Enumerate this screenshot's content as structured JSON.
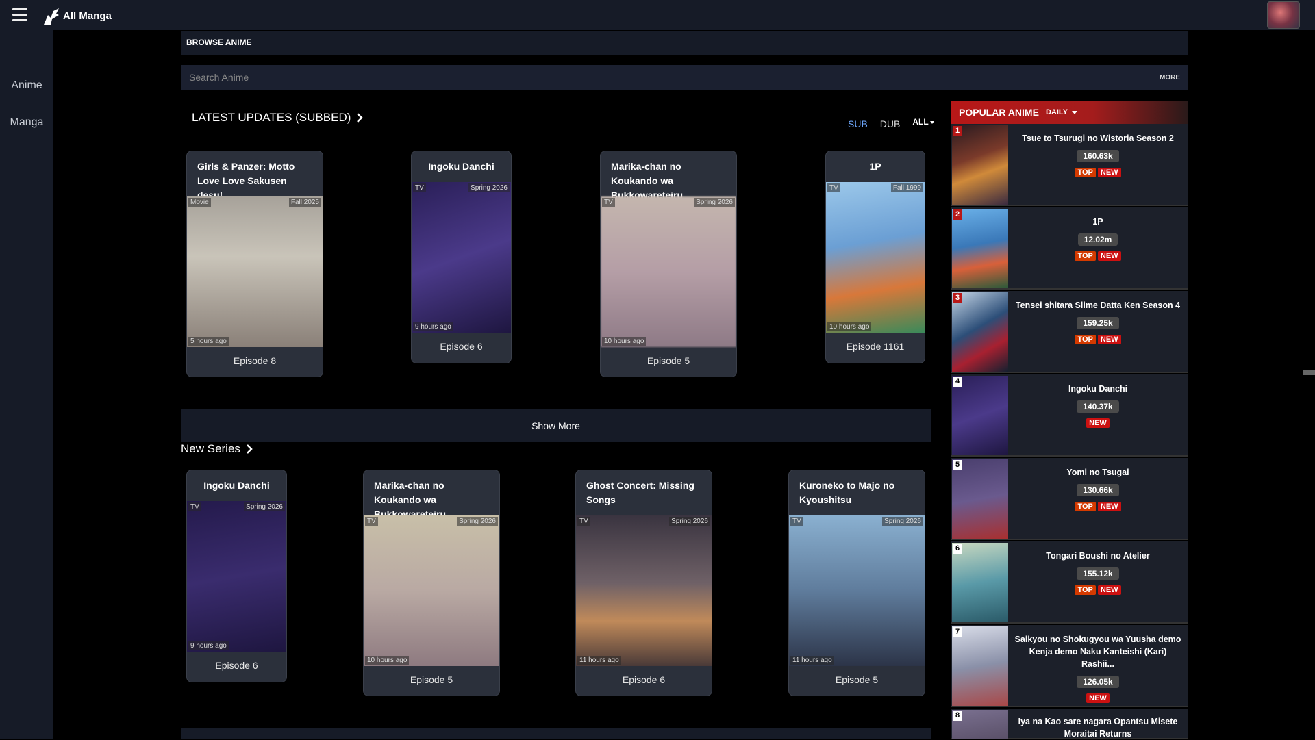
{
  "header": {
    "logo_text": "All Manga"
  },
  "sidebar": {
    "items": [
      {
        "label": "Anime"
      },
      {
        "label": "Manga"
      }
    ]
  },
  "browse": {
    "title": "BROWSE ANIME"
  },
  "search": {
    "placeholder": "Search Anime",
    "more_label": "MORE"
  },
  "latest": {
    "title": "LATEST UPDATES (SUBBED)",
    "toggles": {
      "sub": "SUB",
      "dub": "DUB",
      "all": "ALL"
    },
    "cards": [
      {
        "title": "Girls & Panzer: Motto Love Love Sakusen desu!",
        "type": "Movie",
        "season": "Fall 2025",
        "time": "5 hours ago",
        "episode": "Episode 8",
        "color": "#c9c4b9"
      },
      {
        "title": "Ingoku Danchi",
        "type": "TV",
        "season": "Spring 2026",
        "time": "9 hours ago",
        "episode": "Episode 6",
        "color": "#3b2a6e"
      },
      {
        "title": "Marika-chan no Koukando wa Bukkowareteiru",
        "type": "TV",
        "season": "Spring 2026",
        "time": "10 hours ago",
        "episode": "Episode 5",
        "color": "#b8a6a8"
      },
      {
        "title": "1P",
        "type": "TV",
        "season": "Fall 1999",
        "time": "10 hours ago",
        "episode": "Episode 1161",
        "color": "#6b9fd4"
      }
    ],
    "show_more": "Show More"
  },
  "new_series": {
    "title": "New Series",
    "cards": [
      {
        "title": "Ingoku Danchi",
        "type": "TV",
        "season": "Spring 2026",
        "time": "9 hours ago",
        "episode": "Episode 6",
        "color": "#2f2460"
      },
      {
        "title": "Marika-chan no Koukando wa Bukkowareteiru",
        "type": "TV",
        "season": "Spring 2026",
        "time": "10 hours ago",
        "episode": "Episode 5",
        "color": "#b9a9a3"
      },
      {
        "title": "Ghost Concert: Missing Songs",
        "type": "TV",
        "season": "Spring 2026",
        "time": "11 hours ago",
        "episode": "Episode 6",
        "color": "#6f6167"
      },
      {
        "title": "Kuroneko to Majo no Kyoushitsu",
        "type": "TV",
        "season": "Spring 2026",
        "time": "11 hours ago",
        "episode": "Episode 5",
        "color": "#5f7c9c"
      }
    ]
  },
  "popular": {
    "title": "POPULAR ANIME",
    "period": "DAILY",
    "items": [
      {
        "rank": "1",
        "name": "Tsue to Tsurugi no Wistoria Season 2",
        "views": "160.63k",
        "top": "TOP",
        "new": "NEW",
        "color": "#7a3a2a"
      },
      {
        "rank": "2",
        "name": "1P",
        "views": "12.02m",
        "top": "TOP",
        "new": "NEW",
        "color": "#3a78b8"
      },
      {
        "rank": "3",
        "name": "Tensei shitara Slime Datta Ken Season 4",
        "views": "159.25k",
        "top": "TOP",
        "new": "NEW",
        "color": "#2c4e78"
      },
      {
        "rank": "4",
        "name": "Ingoku Danchi",
        "views": "140.37k",
        "new": "NEW",
        "color": "#3b2a6e"
      },
      {
        "rank": "5",
        "name": "Yomi no Tsugai",
        "views": "130.66k",
        "top": "TOP",
        "new": "NEW",
        "color": "#4a3f6e"
      },
      {
        "rank": "6",
        "name": "Tongari Boushi no Atelier",
        "views": "155.12k",
        "top": "TOP",
        "new": "NEW",
        "color": "#5a9aa8"
      },
      {
        "rank": "7",
        "name": "Saikyou no Shokugyou wa Yuusha demo Kenja demo Naku Kanteishi (Kari) Rashii...",
        "views": "126.05k",
        "new": "NEW",
        "color": "#8a90a8"
      },
      {
        "rank": "8",
        "name": "Iya na Kao sare nagara Opantsu Misete Moraitai Returns",
        "color": "#5a5068"
      }
    ]
  }
}
